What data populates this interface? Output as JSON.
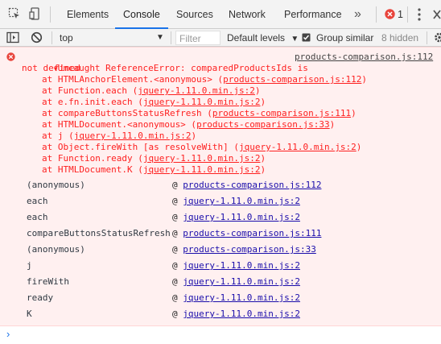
{
  "tabs": {
    "elements": "Elements",
    "console": "Console",
    "sources": "Sources",
    "network": "Network",
    "performance": "Performance",
    "more": "»",
    "error_count": "1"
  },
  "toolbar": {
    "context": "top",
    "filter_placeholder": "Filter",
    "levels": "Default levels",
    "group_similar": "Group similar",
    "hidden": "8 hidden"
  },
  "error": {
    "message": "Uncaught ReferenceError: comparedProductsIds is",
    "message_cont": "not defined",
    "source": "products-comparison.js:112",
    "stack": [
      {
        "prefix": "at HTMLAnchorElement.<anonymous> (",
        "link": "products-comparison.js:112",
        "suffix": ")"
      },
      {
        "prefix": "at Function.each (",
        "link": "jquery-1.11.0.min.js:2",
        "suffix": ")"
      },
      {
        "prefix": "at e.fn.init.each (",
        "link": "jquery-1.11.0.min.js:2",
        "suffix": ")"
      },
      {
        "prefix": "at compareButtonsStatusRefresh (",
        "link": "products-comparison.js:111",
        "suffix": ")"
      },
      {
        "prefix": "at HTMLDocument.<anonymous> (",
        "link": "products-comparison.js:33",
        "suffix": ")"
      },
      {
        "prefix": "at j (",
        "link": "jquery-1.11.0.min.js:2",
        "suffix": ")"
      },
      {
        "prefix": "at Object.fireWith [as resolveWith] (",
        "link": "jquery-1.11.0.min.js:2",
        "suffix": ")"
      },
      {
        "prefix": "at Function.ready (",
        "link": "jquery-1.11.0.min.js:2",
        "suffix": ")"
      },
      {
        "prefix": "at HTMLDocument.K (",
        "link": "jquery-1.11.0.min.js:2",
        "suffix": ")"
      }
    ]
  },
  "frames": [
    {
      "fn": "(anonymous)",
      "link": "products-comparison.js:112"
    },
    {
      "fn": "each",
      "link": "jquery-1.11.0.min.js:2"
    },
    {
      "fn": "each",
      "link": "jquery-1.11.0.min.js:2"
    },
    {
      "fn": "compareButtonsStatusRefresh",
      "link": "products-comparison.js:111"
    },
    {
      "fn": "(anonymous)",
      "link": "products-comparison.js:33"
    },
    {
      "fn": "j",
      "link": "jquery-1.11.0.min.js:2"
    },
    {
      "fn": "fireWith",
      "link": "jquery-1.11.0.min.js:2"
    },
    {
      "fn": "ready",
      "link": "jquery-1.11.0.min.js:2"
    },
    {
      "fn": "K",
      "link": "jquery-1.11.0.min.js:2"
    }
  ],
  "at_symbol": "@",
  "prompt": "›"
}
